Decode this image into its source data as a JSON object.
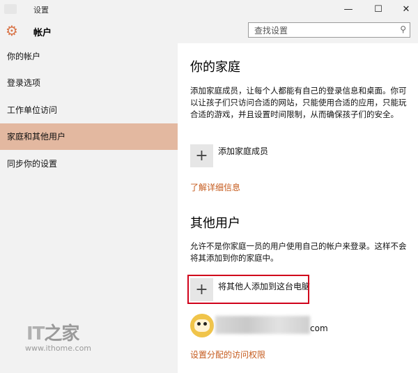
{
  "window": {
    "title": "设置"
  },
  "header": {
    "title": "帐户"
  },
  "search": {
    "placeholder": "查找设置"
  },
  "sidebar": {
    "items": [
      {
        "label": "你的帐户"
      },
      {
        "label": "登录选项"
      },
      {
        "label": "工作单位访问"
      },
      {
        "label": "家庭和其他用户"
      },
      {
        "label": "同步你的设置"
      }
    ]
  },
  "family": {
    "heading": "你的家庭",
    "description": "添加家庭成员，让每个人都能有自己的登录信息和桌面。你可以让孩子们只访问合适的网站，只能使用合适的应用，只能玩合适的游戏，并且设置时间限制，从而确保孩子们的安全。",
    "add_label": "添加家庭成员",
    "learn_more": "了解详细信息"
  },
  "others": {
    "heading": "其他用户",
    "description": "允许不是你家庭一员的用户使用自己的帐户来登录。这样不会将其添加到你的家庭中。",
    "add_label": "将其他人添加到这台电脑",
    "email_suffix": "com",
    "assigned_access": "设置分配的访问权限"
  },
  "watermark": {
    "logo": "IT之家",
    "url": "www.ithome.com"
  },
  "icons": {
    "settings": "gear-icon",
    "search": "search-icon",
    "add": "plus-icon",
    "minimize": "minimize-icon",
    "maximize": "maximize-icon",
    "close": "close-icon"
  },
  "colors": {
    "accent": "#d9764a",
    "active_nav": "#e3b8a0",
    "link": "#c55a1c",
    "highlight": "#d0021b"
  }
}
